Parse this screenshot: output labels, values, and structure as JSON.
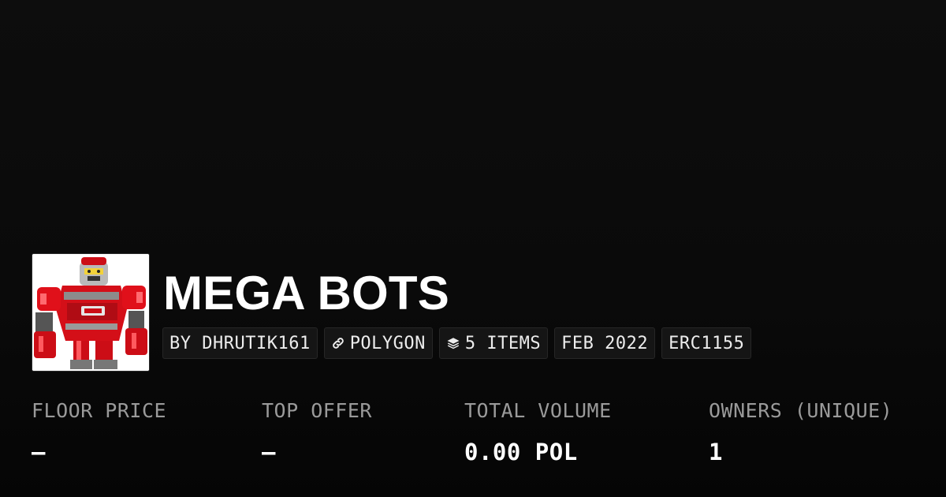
{
  "collection": {
    "name": "MEGA BOTS",
    "image": "robot-avatar"
  },
  "tags": {
    "creator": "BY DHRUTIK161",
    "chain": "POLYGON",
    "chain_icon": "polygon-link-icon",
    "items": "5 ITEMS",
    "items_icon": "layers-icon",
    "date": "FEB 2022",
    "standard": "ERC1155"
  },
  "stats": {
    "floor_price": {
      "label": "FLOOR PRICE",
      "value": "—"
    },
    "top_offer": {
      "label": "TOP OFFER",
      "value": "—"
    },
    "total_volume": {
      "label": "TOTAL VOLUME",
      "value": "0.00 POL"
    },
    "owners": {
      "label": "OWNERS (UNIQUE)",
      "value": "1"
    }
  },
  "colors": {
    "background": "#0a0a0a",
    "text": "#ffffff",
    "muted": "#9a9a9a",
    "tag_bg": "#151515",
    "accent_red": "#e0101a"
  }
}
